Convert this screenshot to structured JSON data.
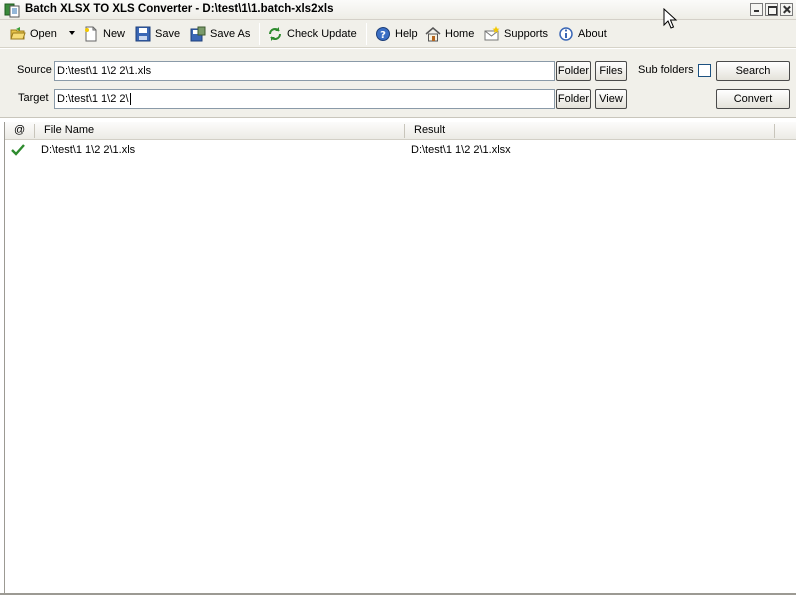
{
  "window": {
    "title": "Batch XLSX TO XLS Converter - D:\\test\\1\\1.batch-xls2xls"
  },
  "toolbar": {
    "open": "Open",
    "new": "New",
    "save": "Save",
    "save_as": "Save As",
    "check_update": "Check Update",
    "help": "Help",
    "home": "Home",
    "supports": "Supports",
    "about": "About"
  },
  "source": {
    "label": "Source",
    "value": "D:\\test\\1 1\\2 2\\1.xls",
    "folder_btn": "Folder",
    "files_btn": "Files",
    "subfolders_label": "Sub folders",
    "subfolders_checked": false,
    "search_btn": "Search"
  },
  "target": {
    "label": "Target",
    "value": "D:\\test\\1 1\\2 2\\",
    "folder_btn": "Folder",
    "view_btn": "View",
    "convert_btn": "Convert"
  },
  "grid": {
    "columns": [
      "@",
      "File Name",
      "Result"
    ],
    "rows": [
      {
        "status": "success-check-icon",
        "file": "D:\\test\\1 1\\2 2\\1.xls",
        "result": "D:\\test\\1 1\\2 2\\1.xlsx"
      }
    ]
  },
  "colors": {
    "toolbar_bg": "#f1f0ea",
    "check_green": "#2e8b2e"
  }
}
